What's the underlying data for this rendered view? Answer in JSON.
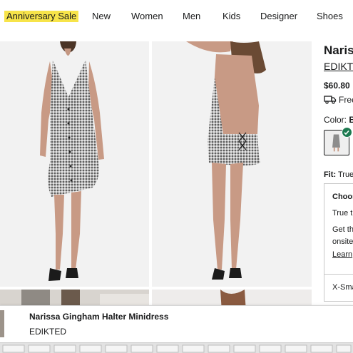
{
  "nav": {
    "items": [
      "Anniversary Sale",
      "New",
      "Women",
      "Men",
      "Kids",
      "Designer",
      "Shoes"
    ]
  },
  "product": {
    "brand_heading": "Nariss",
    "brand_link": "EDIKTE",
    "price": "$60.80",
    "shipping_text": "Free",
    "color_label": "Color:",
    "color_value": "B",
    "fit_label": "Fit:",
    "fit_value": "True",
    "size_box": {
      "title": "Choos",
      "line1": "True t",
      "line2": "Get th",
      "line3": "onsite",
      "link": "Learn"
    },
    "size_option": "X-Sma"
  },
  "sticky_bar": {
    "title": "Narissa Gingham Halter Minidress",
    "brand": "EDIKTED"
  },
  "colors": {
    "sale_highlight": "#f7e44a",
    "selected_check": "#1d7a50",
    "text": "#191a1b"
  },
  "icons": [
    "truck-icon",
    "check-icon"
  ]
}
